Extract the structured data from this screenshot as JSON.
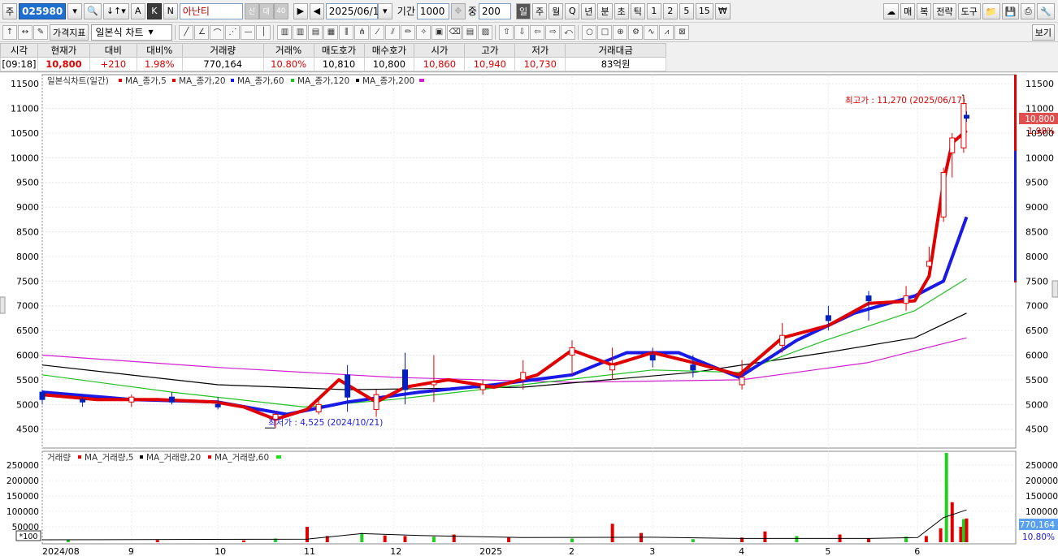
{
  "toolbar": {
    "code_prefix": "주",
    "stock_code": "025980",
    "stock_name": "아난티",
    "badge1": "신",
    "badge2": "대",
    "badge3": "40",
    "date": "2025/06/18",
    "period_label": "기간",
    "period_value": "1000",
    "count_label": "중",
    "count_value": "200",
    "a_label": "A",
    "k_label": "K",
    "n_label": "N",
    "intervals": [
      "일",
      "주",
      "월",
      "Q",
      "년",
      "분",
      "초",
      "틱",
      "1",
      "2",
      "5",
      "15",
      "₩"
    ],
    "right_buttons": [
      "매",
      "복",
      "전략",
      "도구"
    ],
    "indicator_button": "가격지표",
    "chart_type": "일본식 차트",
    "view_button": "보기"
  },
  "quote": {
    "headers": [
      "시각",
      "현재가",
      "대비",
      "대비%",
      "거래량",
      "거래%",
      "매도호가",
      "매수호가",
      "시가",
      "고가",
      "저가",
      "거래대금"
    ],
    "values": [
      "[09:18]",
      "10,800",
      "+210",
      "1.98%",
      "770,164",
      "10.80%",
      "10,810",
      "10,800",
      "10,860",
      "10,940",
      "10,730",
      "83억원"
    ]
  },
  "price_legend": {
    "title": "일본식차트(일간)",
    "items": [
      "MA_종가,5",
      "MA_종가,20",
      "MA_종가,60",
      "MA_종가,120",
      "MA_종가,200"
    ]
  },
  "volume_legend": {
    "title": "거래량",
    "items": [
      "MA_거래량,5",
      "MA_거래량,20",
      "MA_거래량,60"
    ]
  },
  "annotations": {
    "high": "최고가 : 11,270 (2025/06/17)",
    "low": "최저가 : 4,525 (2024/10/21)"
  },
  "price_badges": {
    "current": "10,800",
    "change_pct": "1.98%"
  },
  "volume_badges": {
    "current": "770,164",
    "pct": "10.80%",
    "unit": "*100"
  },
  "colors": {
    "up": "#e00000",
    "down": "#0020c0",
    "ma5": "#e00000",
    "ma20": "#1a1ae6",
    "ma60": "#20c020",
    "ma120": "#000000",
    "ma200": "#d020d0"
  },
  "chart_data": [
    {
      "type": "line",
      "title": "일본식차트(일간)",
      "price_axis_ticks": [
        4500,
        5000,
        5500,
        6000,
        6500,
        7000,
        7500,
        8000,
        8500,
        9000,
        9500,
        10000,
        10500,
        11000,
        11500
      ],
      "ylim": [
        4150,
        11650
      ],
      "x_tick_labels": [
        "2024/08",
        "9",
        "10",
        "11",
        "12",
        "2025",
        "2",
        "3",
        "4",
        "5",
        "6"
      ],
      "x_tick_dates": [
        "2024-08-01",
        "2024-09-01",
        "2024-10-01",
        "2024-11-01",
        "2024-12-01",
        "2025-01-01",
        "2025-02-01",
        "2025-03-01",
        "2025-04-01",
        "2025-05-01",
        "2025-06-01"
      ],
      "x_range": [
        "2024-08-01",
        "2025-06-30"
      ],
      "series": [
        {
          "name": "MA_종가,5",
          "dates": [
            "2024-08-01",
            "2024-08-20",
            "2024-09-10",
            "2024-09-30",
            "2024-10-10",
            "2024-10-21",
            "2024-11-01",
            "2024-11-12",
            "2024-11-25",
            "2024-12-05",
            "2024-12-20",
            "2025-01-05",
            "2025-01-20",
            "2025-02-01",
            "2025-02-15",
            "2025-03-01",
            "2025-03-15",
            "2025-03-31",
            "2025-04-15",
            "2025-05-01",
            "2025-05-15",
            "2025-05-31",
            "2025-06-05",
            "2025-06-10",
            "2025-06-13",
            "2025-06-18"
          ],
          "values": [
            5200,
            5100,
            5100,
            5050,
            4950,
            4700,
            4900,
            5500,
            5050,
            5350,
            5500,
            5350,
            5600,
            6100,
            5800,
            6050,
            5850,
            5600,
            6350,
            6600,
            7050,
            7100,
            7600,
            9500,
            10300,
            10550
          ]
        },
        {
          "name": "MA_종가,20",
          "dates": [
            "2024-08-01",
            "2024-09-01",
            "2024-10-01",
            "2024-10-25",
            "2024-11-15",
            "2024-12-10",
            "2025-01-05",
            "2025-02-01",
            "2025-02-20",
            "2025-03-10",
            "2025-03-31",
            "2025-04-20",
            "2025-05-10",
            "2025-05-31",
            "2025-06-10",
            "2025-06-18"
          ],
          "values": [
            5250,
            5100,
            5050,
            4800,
            5050,
            5250,
            5400,
            5600,
            6050,
            6050,
            5550,
            6300,
            6850,
            7200,
            7500,
            8800
          ]
        },
        {
          "name": "MA_종가,60",
          "dates": [
            "2024-08-01",
            "2024-09-15",
            "2024-10-31",
            "2024-12-01",
            "2025-01-15",
            "2025-03-01",
            "2025-03-31",
            "2025-04-30",
            "2025-05-31",
            "2025-06-18"
          ],
          "values": [
            5600,
            5250,
            4950,
            5100,
            5400,
            5700,
            5650,
            6300,
            6900,
            7550
          ]
        },
        {
          "name": "MA_종가,120",
          "dates": [
            "2024-08-01",
            "2024-10-01",
            "2024-11-15",
            "2025-01-15",
            "2025-03-15",
            "2025-04-30",
            "2025-05-31",
            "2025-06-18"
          ],
          "values": [
            5800,
            5400,
            5300,
            5350,
            5650,
            6050,
            6350,
            6850
          ]
        },
        {
          "name": "MA_종가,200",
          "dates": [
            "2024-08-01",
            "2024-10-01",
            "2024-12-01",
            "2025-02-01",
            "2025-04-01",
            "2025-05-15",
            "2025-06-18"
          ],
          "values": [
            6000,
            5750,
            5550,
            5450,
            5500,
            5850,
            6350
          ]
        }
      ],
      "candles": {
        "dates": [
          "2024-08-01",
          "2024-08-15",
          "2024-09-01",
          "2024-09-15",
          "2024-10-01",
          "2024-10-21",
          "2024-11-05",
          "2024-11-15",
          "2024-11-25",
          "2024-12-05",
          "2024-12-15",
          "2025-01-01",
          "2025-01-15",
          "2025-02-01",
          "2025-02-15",
          "2025-03-01",
          "2025-03-15",
          "2025-04-01",
          "2025-04-15",
          "2025-05-01",
          "2025-05-15",
          "2025-05-28",
          "2025-06-05",
          "2025-06-10",
          "2025-06-13",
          "2025-06-17",
          "2025-06-18"
        ],
        "open": [
          5250,
          5100,
          5050,
          5150,
          5000,
          4700,
          4850,
          5600,
          4900,
          5700,
          5400,
          5300,
          5500,
          6000,
          5700,
          6000,
          5800,
          5400,
          6200,
          6800,
          7200,
          7050,
          7800,
          8800,
          10100,
          10200,
          10860
        ],
        "high": [
          5300,
          5150,
          5200,
          5250,
          5150,
          4850,
          5100,
          5800,
          5300,
          6050,
          6000,
          5500,
          5900,
          6300,
          6150,
          6150,
          6000,
          5900,
          6650,
          7000,
          7300,
          7400,
          8200,
          9800,
          10500,
          11270,
          10940
        ],
        "low": [
          5000,
          4950,
          4950,
          5000,
          4900,
          4525,
          4800,
          4850,
          4750,
          5000,
          5050,
          5200,
          5300,
          5600,
          5500,
          5750,
          5550,
          5300,
          6050,
          6500,
          6700,
          6900,
          7600,
          8700,
          9600,
          10100,
          10730
        ],
        "close": [
          5100,
          5050,
          5150,
          5050,
          4950,
          4800,
          5000,
          5150,
          5200,
          5300,
          5450,
          5400,
          5650,
          6150,
          5800,
          5900,
          5700,
          5550,
          6400,
          6700,
          7100,
          7200,
          7900,
          9700,
          10400,
          11100,
          10800
        ]
      },
      "high_annotation": {
        "date": "2025-06-17",
        "value": 11270
      },
      "low_annotation": {
        "date": "2024-10-21",
        "value": 4525
      }
    },
    {
      "type": "bar",
      "title": "거래량",
      "volume_axis_ticks": [
        50000,
        100000,
        150000,
        200000,
        250000
      ],
      "ylim": [
        0,
        290000
      ],
      "dates": [
        "2024-08-10",
        "2024-09-10",
        "2024-10-10",
        "2024-10-21",
        "2024-11-01",
        "2024-11-08",
        "2024-11-20",
        "2024-11-28",
        "2024-12-05",
        "2024-12-15",
        "2024-12-22",
        "2025-01-10",
        "2025-02-01",
        "2025-02-15",
        "2025-02-25",
        "2025-03-15",
        "2025-04-01",
        "2025-04-09",
        "2025-04-20",
        "2025-05-05",
        "2025-05-15",
        "2025-05-28",
        "2025-06-04",
        "2025-06-09",
        "2025-06-11",
        "2025-06-13",
        "2025-06-16",
        "2025-06-17",
        "2025-06-18"
      ],
      "values": [
        8000,
        7000,
        6000,
        12000,
        50000,
        20000,
        30000,
        22000,
        20000,
        18000,
        25000,
        15000,
        12000,
        60000,
        30000,
        10000,
        15000,
        35000,
        20000,
        25000,
        12000,
        18000,
        20000,
        45000,
        290000,
        130000,
        50000,
        75000,
        77016
      ],
      "ma20": {
        "dates": [
          "2024-08-01",
          "2024-11-01",
          "2024-11-20",
          "2024-12-10",
          "2025-01-15",
          "2025-03-01",
          "2025-04-01",
          "2025-05-15",
          "2025-06-01",
          "2025-06-10",
          "2025-06-18"
        ],
        "values": [
          8000,
          10000,
          28000,
          22000,
          15000,
          16000,
          12000,
          12000,
          15000,
          80000,
          105000
        ]
      }
    }
  ]
}
